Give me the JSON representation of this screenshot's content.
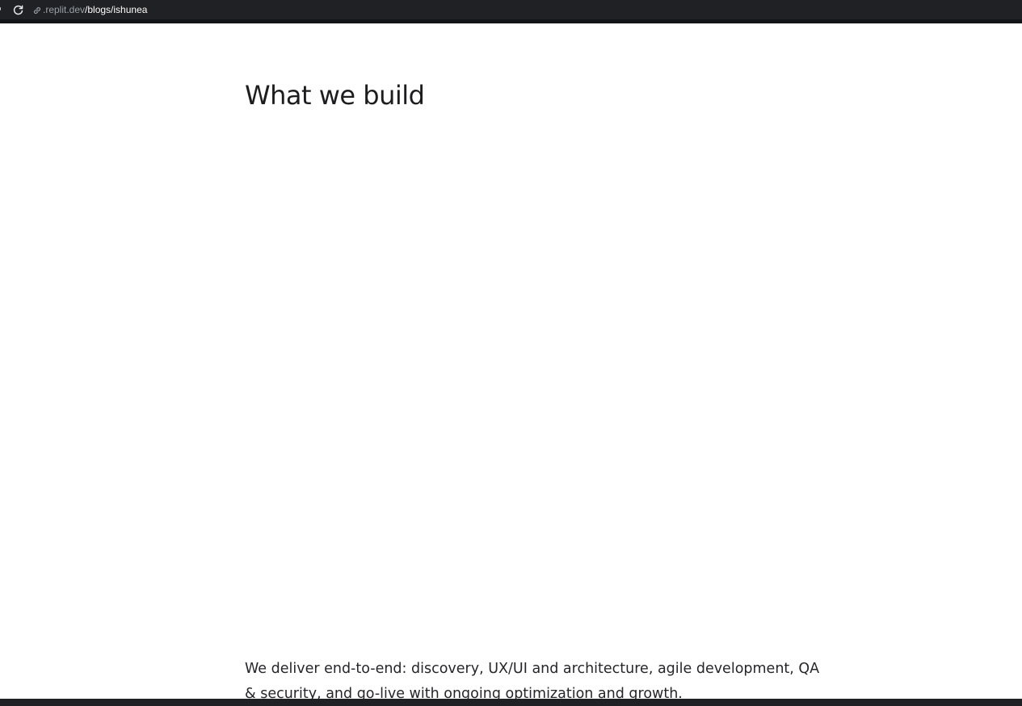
{
  "browser": {
    "url_host": ".replit.dev",
    "url_path": "/blogs/ishunea"
  },
  "main": {
    "heading": "What we build",
    "description": "We deliver end-to-end: discovery, UX/UI and architecture, agile development, QA & security, and go-live with ongoing optimization and growth."
  },
  "icons": {
    "reload": "reload-icon",
    "link": "link-icon",
    "back": "back-arrow-icon"
  },
  "colors": {
    "browser_chrome": "#202124",
    "url_host": "#9aa0a6",
    "url_path": "#ffffff",
    "page_background": "#ffffff",
    "heading_text": "#1d1d1f",
    "body_text": "#26262a"
  }
}
